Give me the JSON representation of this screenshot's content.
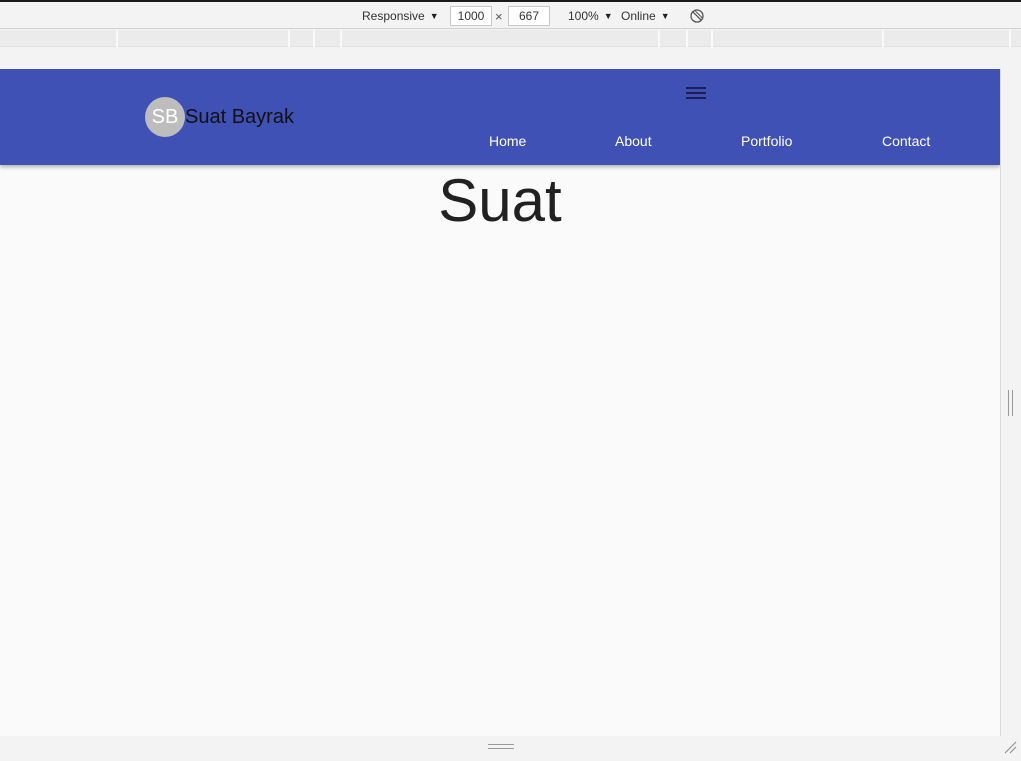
{
  "devtools": {
    "device_mode": "Responsive",
    "width_value": "1000",
    "times_symbol": "×",
    "height_value": "667",
    "zoom": "100%",
    "throttling": "Online",
    "rotate_icon": "rotate-icon"
  },
  "site": {
    "avatar_initials": "SB",
    "brand_name": "Suat Bayrak",
    "menu_icon": "hamburger-menu-icon",
    "nav": [
      {
        "label": "Home"
      },
      {
        "label": "About"
      },
      {
        "label": "Portfolio"
      },
      {
        "label": "Contact"
      }
    ],
    "hero_title": "Suat"
  },
  "colors": {
    "app_bar": "#3f51b5",
    "avatar_bg": "#bdbdbd",
    "page_bg": "#fafafa"
  }
}
